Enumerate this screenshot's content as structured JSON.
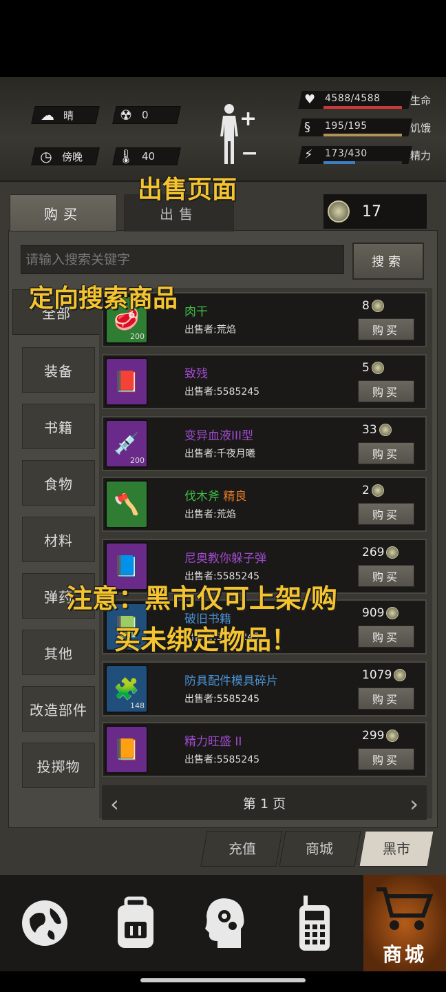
{
  "status": {
    "weather": "晴",
    "radiation": "0",
    "time_of_day": "傍晚",
    "temperature": "40",
    "stats": [
      {
        "label": "生命",
        "value": "4588/4588",
        "fill": 1.0,
        "color": "#c83a3a"
      },
      {
        "label": "饥饿",
        "value": "195/195",
        "fill": 1.0,
        "color": "#b0925a"
      },
      {
        "label": "精力",
        "value": "173/430",
        "fill": 0.4,
        "color": "#3e7fc2"
      }
    ]
  },
  "tabs": {
    "buy": "购买",
    "sell": "出售"
  },
  "currency": {
    "value": "17"
  },
  "search": {
    "placeholder": "请输入搜索关键字",
    "button": "搜索"
  },
  "categories": [
    "全部",
    "装备",
    "书籍",
    "食物",
    "材料",
    "弹药",
    "其他",
    "改造部件",
    "投掷物"
  ],
  "items": [
    {
      "name": "肉干",
      "name_color": "#3fbf4a",
      "seller": "出售者:荒焰",
      "price": "8",
      "qty": "200",
      "icon_bg": "#2e7d32",
      "icon": "🥩"
    },
    {
      "name": "致残",
      "name_color": "#a04ad0",
      "seller": "出售者:5585245",
      "price": "5",
      "qty": "",
      "icon_bg": "#6a2a8a",
      "icon": "📕"
    },
    {
      "name": "变异血液III型",
      "name_color": "#a04ad0",
      "seller": "出售者:千夜月曦",
      "price": "33",
      "qty": "200",
      "icon_bg": "#6a2a8a",
      "icon": "💉"
    },
    {
      "name": "伐木斧",
      "name_suffix": "精良",
      "name_color": "#3fbf4a",
      "seller": "出售者:荒焰",
      "price": "2",
      "qty": "",
      "icon_bg": "#2e7d32",
      "icon": "🪓"
    },
    {
      "name": "尼奥教你躲子弹",
      "name_color": "#a04ad0",
      "seller": "出售者:5585245",
      "price": "269",
      "qty": "",
      "icon_bg": "#6a2a8a",
      "icon": "📘"
    },
    {
      "name": "破旧书籍",
      "name_color": "#4a90d0",
      "seller": "出售者:5585245",
      "price": "909",
      "qty": "",
      "icon_bg": "#1f4f7a",
      "icon": "📗"
    },
    {
      "name": "防具配件模具碎片",
      "name_color": "#4a90d0",
      "seller": "出售者:5585245",
      "price": "1079",
      "qty": "148",
      "icon_bg": "#1f4f7a",
      "icon": "🧩"
    },
    {
      "name": "精力旺盛 II",
      "name_color": "#a04ad0",
      "seller": "出售者:5585245",
      "price": "299",
      "qty": "",
      "icon_bg": "#6a2a8a",
      "icon": "📙"
    }
  ],
  "buy_label": "购买",
  "pager": {
    "label": "第 1 页"
  },
  "shop_tabs": [
    "充值",
    "商城",
    "黑市"
  ],
  "nav": {
    "active_label": "商城"
  },
  "annotations": {
    "sell_page": "出售页面",
    "search_note": "定向搜索商品",
    "warning_line1": "注意：黑市仅可上架/购",
    "warning_line2": "买未绑定物品！"
  }
}
